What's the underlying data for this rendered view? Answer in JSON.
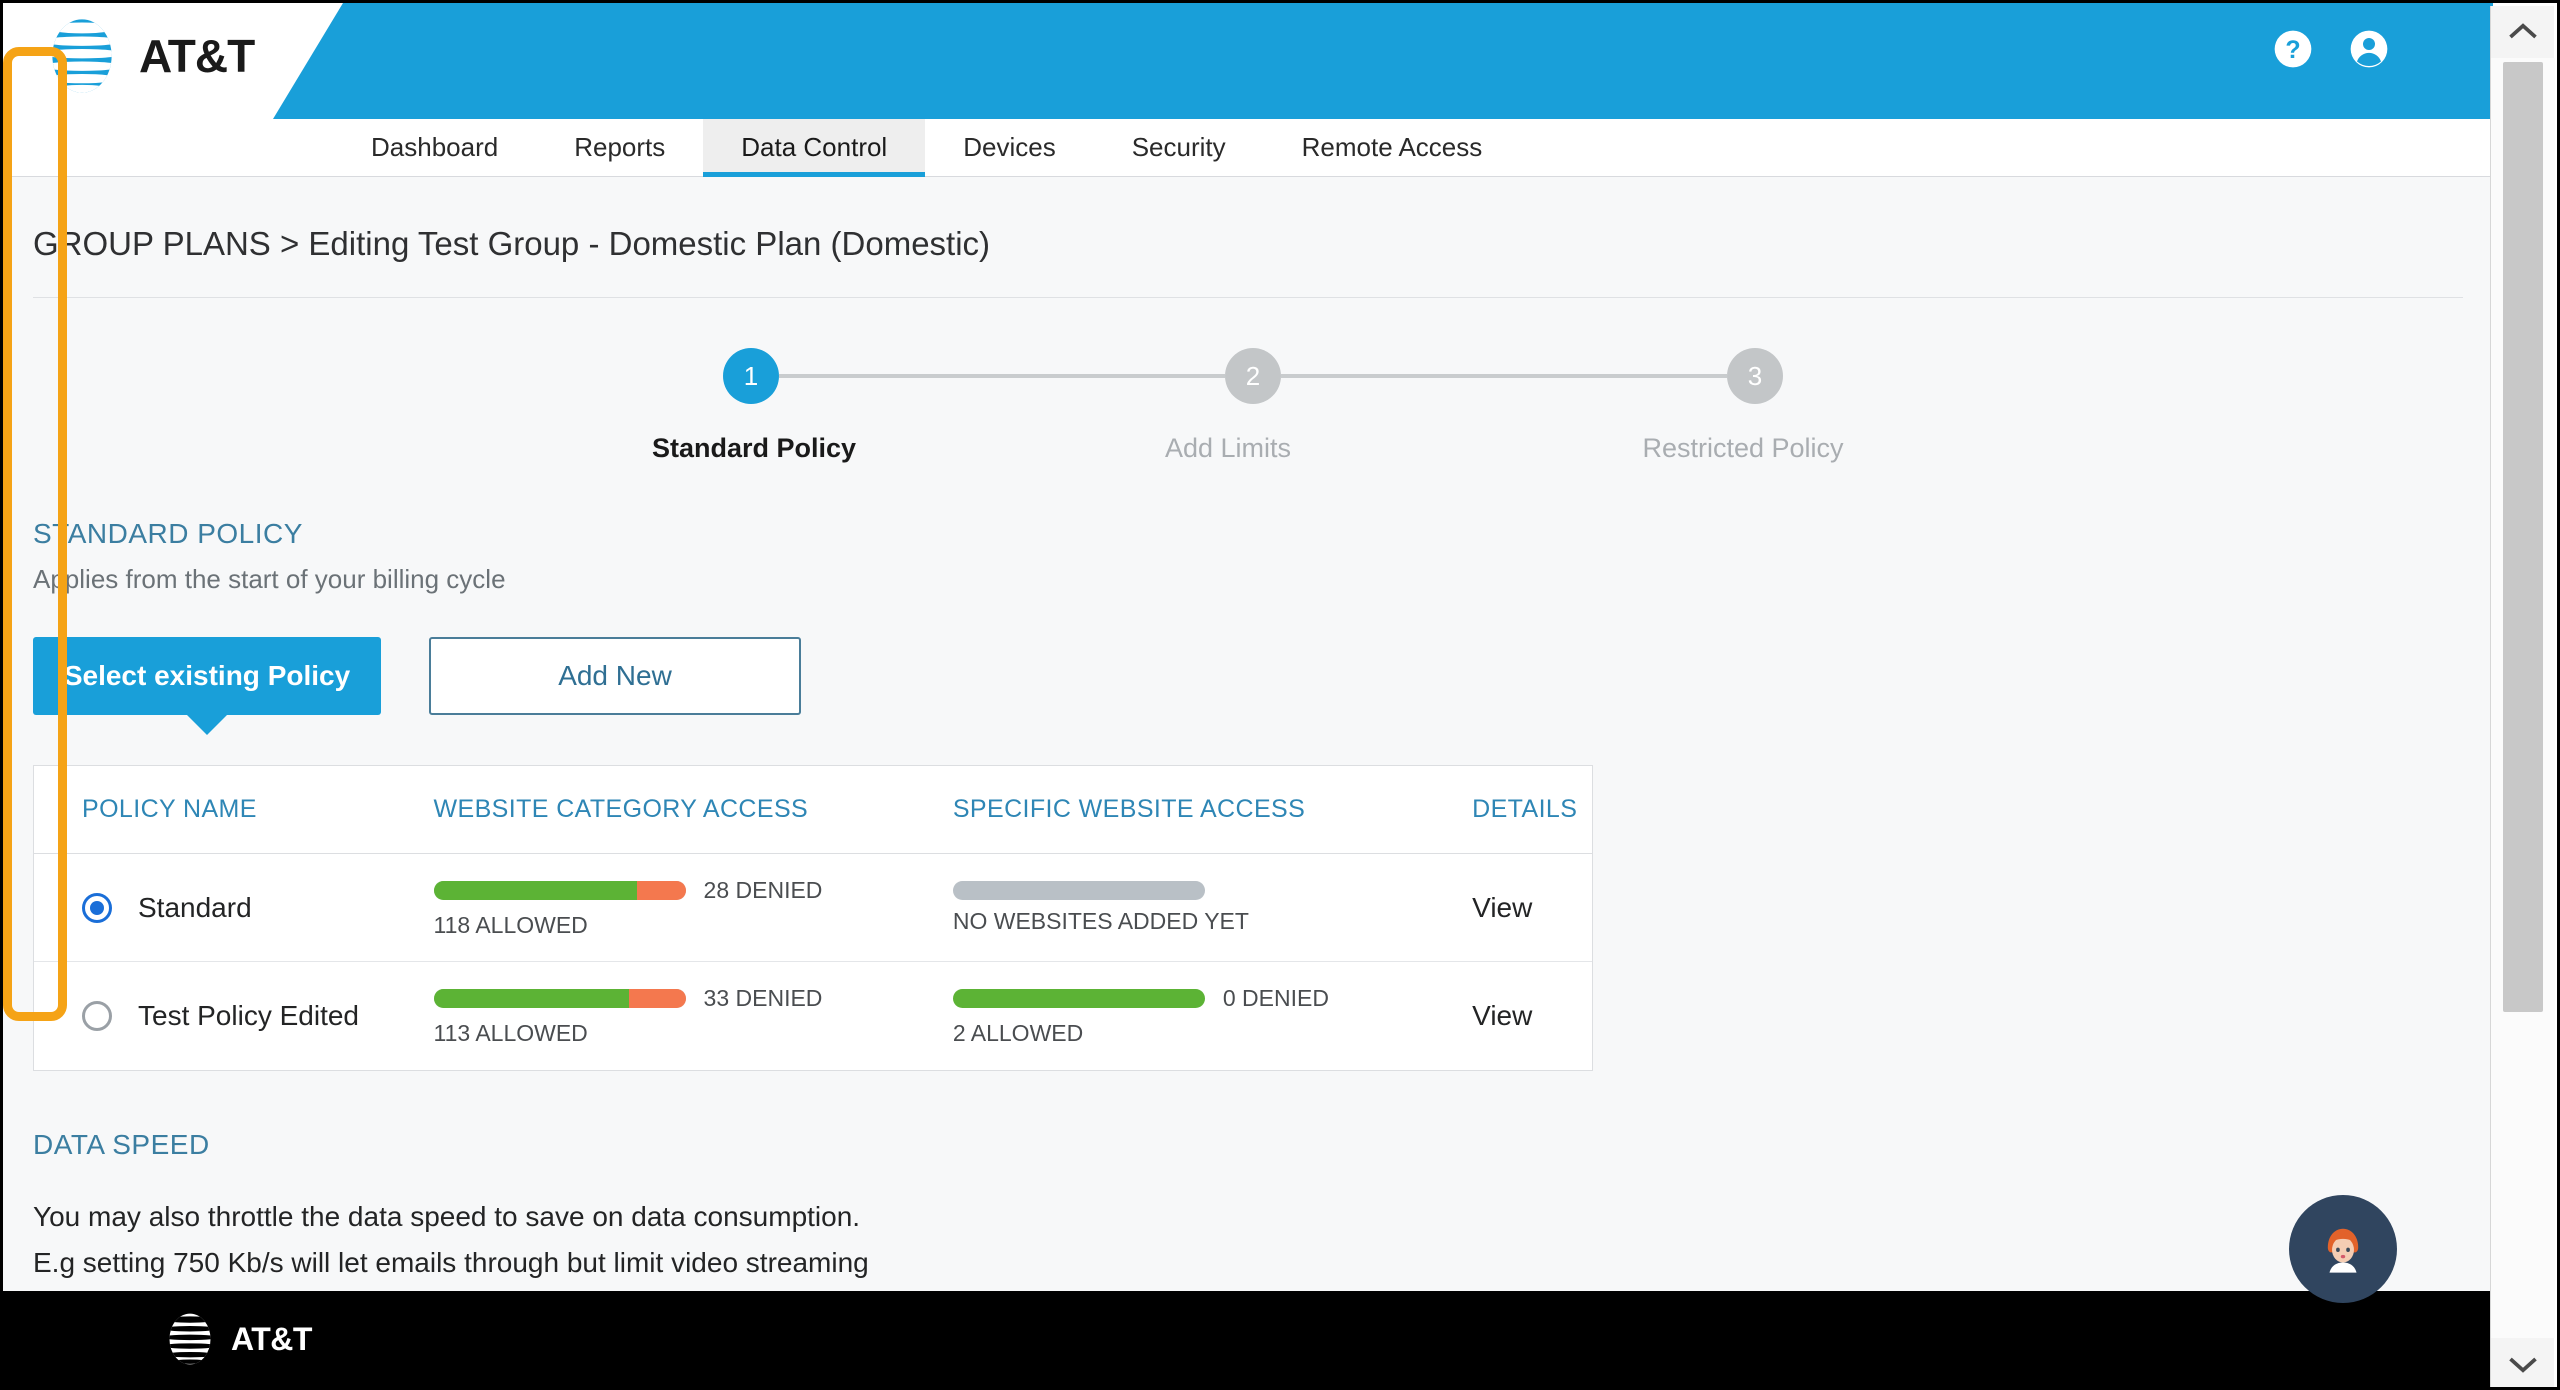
{
  "header": {
    "brand": "AT&T",
    "help_icon": "help-circle-icon",
    "account_icon": "account-circle-icon"
  },
  "nav": {
    "items": [
      {
        "label": "Dashboard",
        "active": false
      },
      {
        "label": "Reports",
        "active": false
      },
      {
        "label": "Data Control",
        "active": true
      },
      {
        "label": "Devices",
        "active": false
      },
      {
        "label": "Security",
        "active": false
      },
      {
        "label": "Remote Access",
        "active": false
      }
    ]
  },
  "breadcrumb": "GROUP PLANS > Editing Test Group - Domestic Plan (Domestic)",
  "stepper": {
    "steps": [
      {
        "number": "1",
        "label": "Standard Policy",
        "state": "active"
      },
      {
        "number": "2",
        "label": "Add Limits",
        "state": "inactive"
      },
      {
        "number": "3",
        "label": "Restricted Policy",
        "state": "inactive"
      }
    ]
  },
  "standard_policy": {
    "title": "STANDARD POLICY",
    "subtitle": "Applies from the start of your billing cycle",
    "mode_buttons": {
      "select_existing": "Select existing Policy",
      "add_new": "Add New"
    },
    "table": {
      "columns": [
        "POLICY NAME",
        "WEBSITE CATEGORY ACCESS",
        "SPECIFIC WEBSITE ACCESS",
        "DETAILS"
      ],
      "rows": [
        {
          "name": "Standard",
          "selected": true,
          "category_access": {
            "allowed_label": "118 ALLOWED",
            "denied_label": "28 DENIED",
            "allowed": 118,
            "denied": 28,
            "empty": false
          },
          "website_access": {
            "allowed_label": "",
            "denied_label": "",
            "empty_label": "NO WEBSITES ADDED YET",
            "allowed": 0,
            "denied": 0,
            "empty": true
          },
          "details": "View"
        },
        {
          "name": "Test Policy Edited",
          "selected": false,
          "category_access": {
            "allowed_label": "113 ALLOWED",
            "denied_label": "33 DENIED",
            "allowed": 113,
            "denied": 33,
            "empty": false
          },
          "website_access": {
            "allowed_label": "2 ALLOWED",
            "denied_label": "0 DENIED",
            "empty_label": "",
            "allowed": 2,
            "denied": 0,
            "empty": false
          },
          "details": "View"
        }
      ]
    }
  },
  "data_speed": {
    "title": "DATA SPEED",
    "line1": "You may also throttle the data speed to save on data consumption.",
    "line2": "E.g setting 750 Kb/s will let emails through but limit video streaming"
  },
  "footer": {
    "brand": "AT&T"
  },
  "assistant": {
    "icon": "virtual-assistant-avatar-icon"
  },
  "scrollbar": {
    "up_icon": "chevron-up-icon",
    "down_icon": "chevron-down-icon",
    "highlight_color": "#f5a316"
  },
  "colors": {
    "brand_blue": "#199fd9",
    "allowed_green": "#5cb335",
    "denied_orange": "#f4784e",
    "empty_gray": "#b9c0c6",
    "section_heading": "#3b7ea1",
    "radio_blue": "#1a6ed8"
  }
}
